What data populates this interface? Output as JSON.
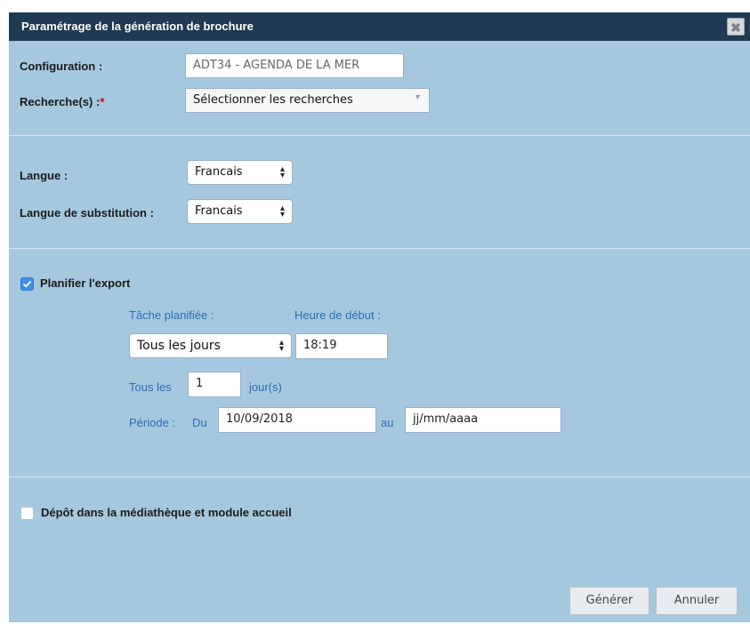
{
  "dialog": {
    "title": "Paramétrage de la génération de brochure",
    "close_symbol": "✖"
  },
  "configuration": {
    "label": "Configuration :",
    "value": "ADT34 - AGENDA DE LA MER"
  },
  "recherches": {
    "label": "Recherche(s) :",
    "required_mark": "*",
    "value": "Sélectionner les recherches"
  },
  "langue": {
    "label": "Langue :",
    "value": "Francais"
  },
  "langue_substitution": {
    "label": "Langue de substitution :",
    "value": "Francais"
  },
  "planifier": {
    "label": "Planifier l'export",
    "checked": true,
    "tache_label": "Tâche planifiée :",
    "heure_label": "Heure de début :",
    "tache_value": "Tous les jours",
    "heure_value": "18:19",
    "tous_les_label": "Tous les",
    "tous_les_value": "1",
    "jours_label": "jour(s)",
    "periode_label": "Période :",
    "du_label": "Du",
    "du_value": "10/09/2018",
    "au_label": "au",
    "au_placeholder": "jj/mm/aaaa"
  },
  "depot": {
    "label": "Dépôt dans la médiathèque et module accueil",
    "checked": false
  },
  "buttons": {
    "generer": "Générer",
    "annuler": "Annuler"
  },
  "colors": {
    "panel_bg": "#a6c8df",
    "titlebar_bg": "#1f3a52",
    "accent_blue": "#2a6cb4",
    "checkbox_blue": "#3d8ee8"
  }
}
